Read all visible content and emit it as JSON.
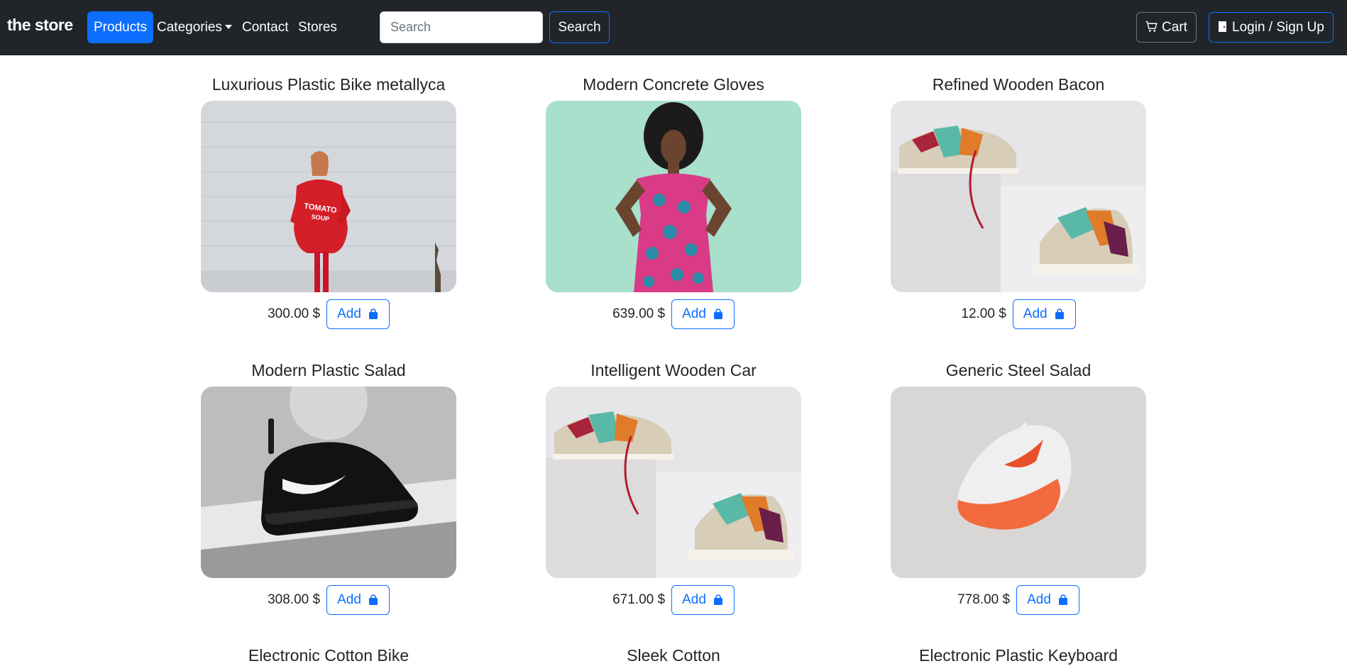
{
  "nav": {
    "brand": "the store",
    "items": [
      {
        "label": "Products",
        "active": true
      },
      {
        "label": "Categories",
        "dropdown": true
      },
      {
        "label": "Contact"
      },
      {
        "label": "Stores"
      }
    ],
    "search_placeholder": "Search",
    "search_button": "Search",
    "cart_label": "Cart",
    "login_label": "Login / Sign Up",
    "accent": "#0d6efd",
    "background": "#212529"
  },
  "products": [
    {
      "name": "Luxurious Plastic Bike metallyca",
      "price": "300.00 $",
      "add_label": "Add",
      "image": "woman-red-sweater"
    },
    {
      "name": "Modern Concrete Gloves",
      "price": "639.00 $",
      "add_label": "Add",
      "image": "woman-floral-dress"
    },
    {
      "name": "Refined Wooden Bacon",
      "price": "12.00 $",
      "add_label": "Add",
      "image": "sneakers-pair"
    },
    {
      "name": "Modern Plastic Salad",
      "price": "308.00 $",
      "add_label": "Add",
      "image": "black-sneaker"
    },
    {
      "name": "Intelligent Wooden Car",
      "price": "671.00 $",
      "add_label": "Add",
      "image": "sneakers-pair"
    },
    {
      "name": "Generic Steel Salad",
      "price": "778.00 $",
      "add_label": "Add",
      "image": "orange-sneaker"
    },
    {
      "name": "Electronic Cotton Bike"
    },
    {
      "name": "Sleek Cotton"
    },
    {
      "name": "Electronic Plastic Keyboard"
    }
  ]
}
